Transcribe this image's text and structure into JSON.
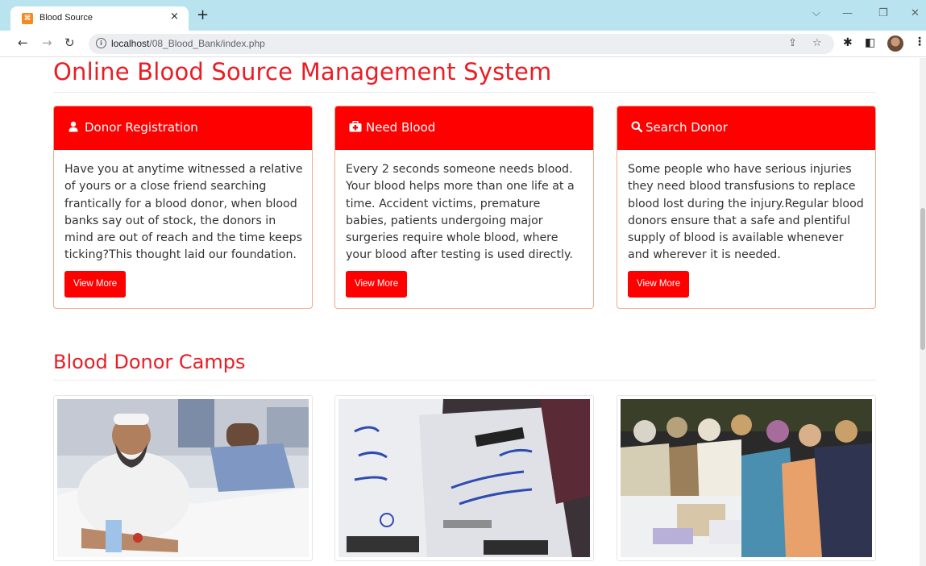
{
  "browser": {
    "tab_title": "Blood Source",
    "tab_close": "×",
    "new_tab": "+",
    "url_host": "localhost",
    "url_path": "/08_Blood_Bank/index.php",
    "window_controls": {
      "dropdown": "⌵",
      "minimize": "—",
      "restore": "❐",
      "close": "✕"
    }
  },
  "page": {
    "title": "Online Blood Source Management System",
    "cards": [
      {
        "icon": "user-icon",
        "title": "Donor Registration",
        "body": "Have you at anytime witnessed a relative of yours or a close friend searching frantically for a blood donor, when blood banks say out of stock, the donors in mind are out of reach and the time keeps ticking?This thought laid our foundation.",
        "button": "View More"
      },
      {
        "icon": "medkit-icon",
        "title": "Need Blood",
        "body": "Every 2 seconds someone needs blood. Your blood helps more than one life at a time. Accident victims, premature babies, patients undergoing major surgeries require whole blood, where your blood after testing is used directly.",
        "button": "View More"
      },
      {
        "icon": "search-icon",
        "title": "Search Donor",
        "body": "Some people who have serious injuries they need blood transfusions to replace blood lost during the injury.Regular blood donors ensure that a safe and plentiful supply of blood is available whenever and wherever it is needed.",
        "button": "View More"
      }
    ],
    "camps_title": "Blood Donor Camps"
  },
  "colors": {
    "brand_red": "#ff0000",
    "heading_red": "#ea1c24",
    "tab_bar": "#b9e3ef"
  }
}
